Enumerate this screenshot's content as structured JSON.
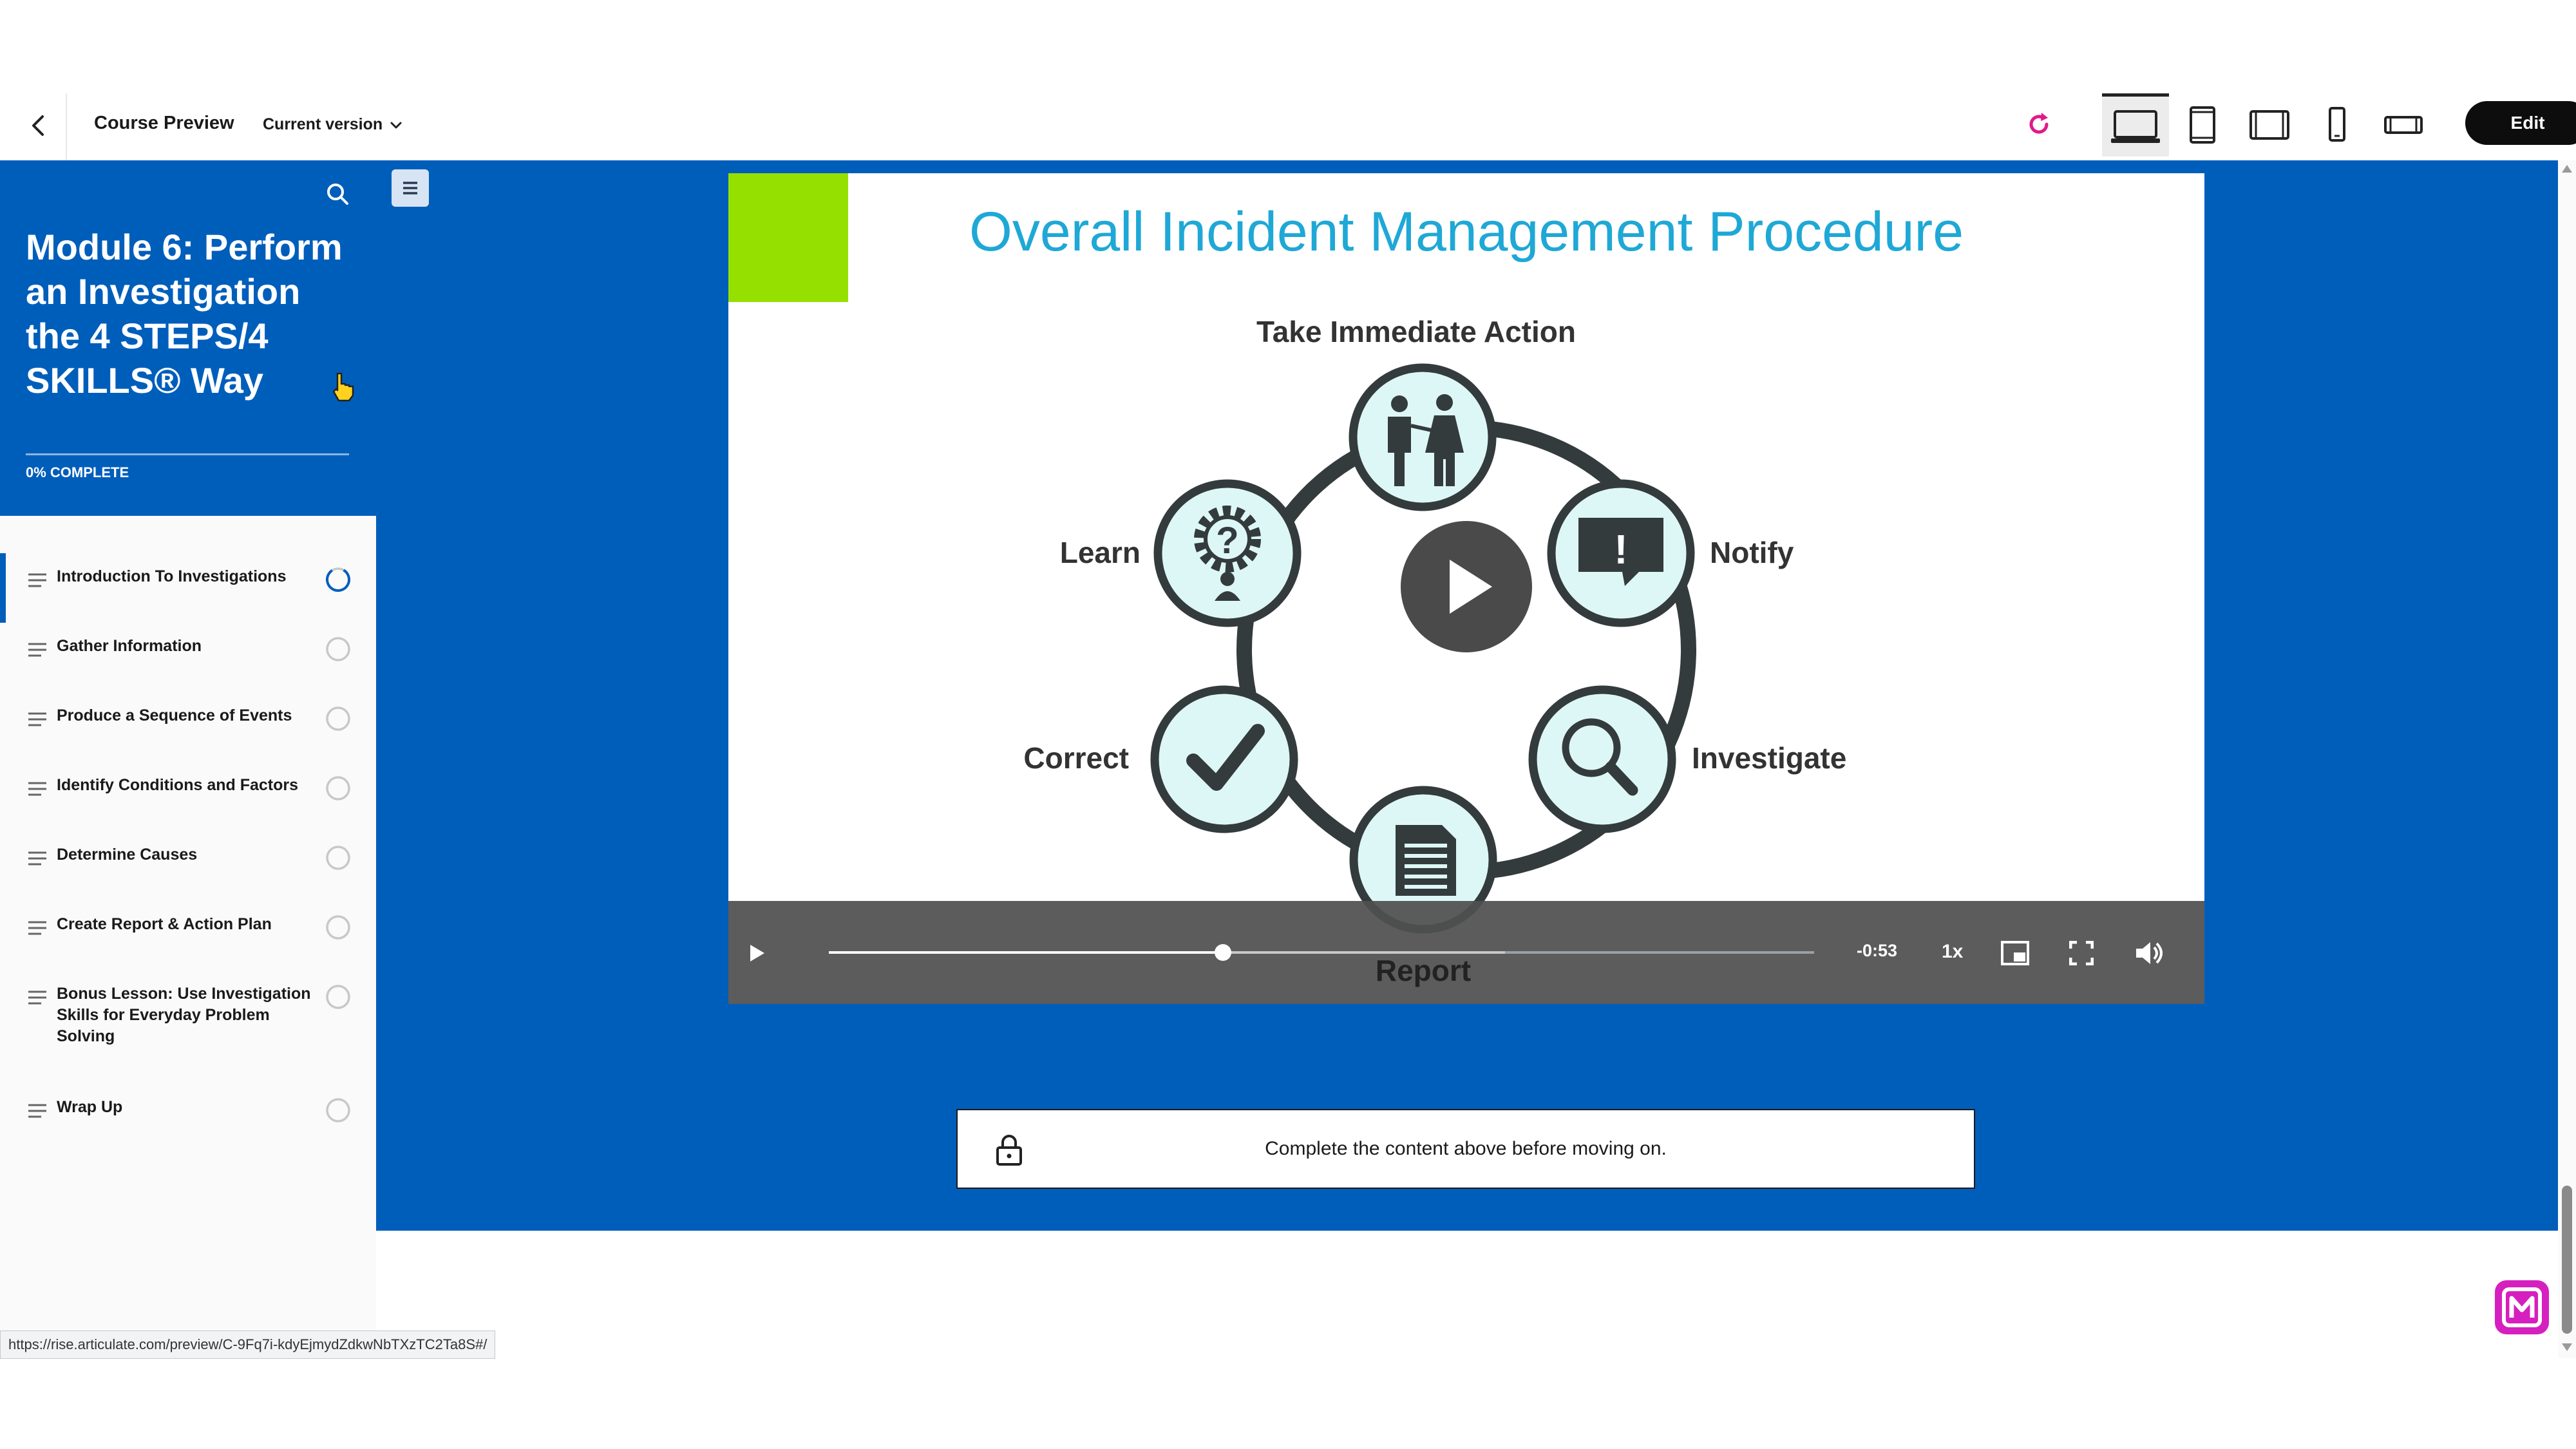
{
  "topbar": {
    "title": "Course Preview",
    "version": "Current version",
    "edit_label": "Edit",
    "accent": "#e0198a"
  },
  "sidebar": {
    "course_title": "Module 6: Perform an Investigation the 4 STEPS/4 SKILLS® Way",
    "progress": "0% COMPLETE",
    "header_color": "#005ebb",
    "lessons": [
      {
        "label": "Introduction To Investigations",
        "status": "in-progress"
      },
      {
        "label": "Gather Information",
        "status": "not-started"
      },
      {
        "label": "Produce a Sequence of Events",
        "status": "not-started"
      },
      {
        "label": "Identify Conditions and Factors",
        "status": "not-started"
      },
      {
        "label": "Determine Causes",
        "status": "not-started"
      },
      {
        "label": "Create Report & Action Plan",
        "status": "not-started"
      },
      {
        "label": "Bonus Lesson: Use Investigation Skills for Everyday Problem Solving",
        "status": "not-started"
      },
      {
        "label": "Wrap Up",
        "status": "not-started"
      }
    ]
  },
  "video": {
    "title": "Overall Incident Management Procedure",
    "steps": {
      "take_action": "Take Immediate Action",
      "notify": "Notify",
      "investigate": "Investigate",
      "report": "Report",
      "correct": "Correct",
      "learn": "Learn"
    },
    "time_remaining": "-0:53",
    "speed": "1x",
    "progress": 0.4
  },
  "lock_message": "Complete the content above before moving on.",
  "status_url": "https://rise.articulate.com/preview/C-9Fq7i-kdyEjmydZdkwNbTXzTC2Ta8S#/"
}
